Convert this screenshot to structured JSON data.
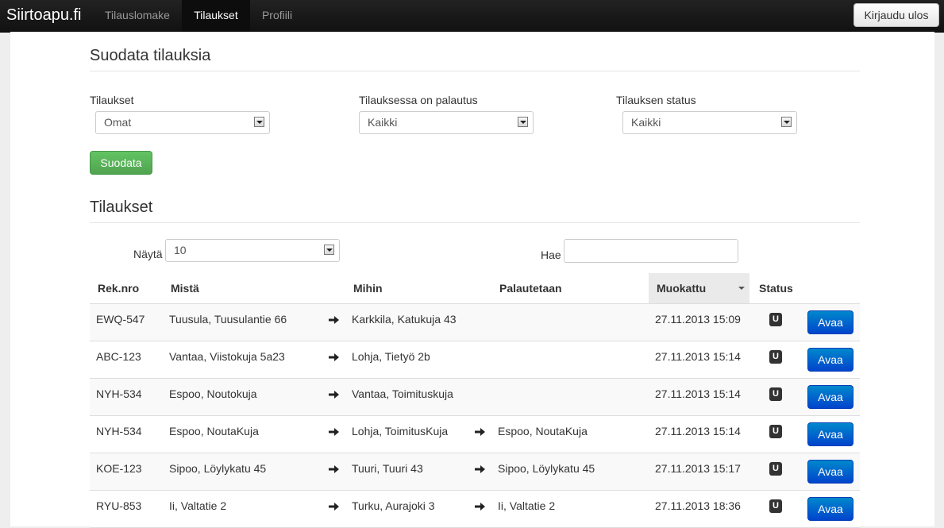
{
  "navbar": {
    "brand": "Siirtoapu.fi",
    "items": [
      {
        "label": "Tilauslomake"
      },
      {
        "label": "Tilaukset"
      },
      {
        "label": "Profiili"
      }
    ],
    "logout_label": "Kirjaudu ulos"
  },
  "filter": {
    "title": "Suodata tilauksia",
    "orders_label": "Tilaukset",
    "orders_value": "Omat",
    "return_label": "Tilauksessa on palautus",
    "return_value": "Kaikki",
    "status_label": "Tilauksen status",
    "status_value": "Kaikki",
    "submit_label": "Suodata"
  },
  "orders": {
    "title": "Tilaukset",
    "show_label": "Näytä",
    "show_value": "10",
    "search_label": "Hae",
    "search_value": "",
    "columns": {
      "reg": "Rek.nro",
      "from": "Mistä",
      "to": "Mihin",
      "return": "Palautetaan",
      "modified": "Muokattu",
      "status": "Status"
    },
    "open_label": "Avaa",
    "rows": [
      {
        "reg": "EWQ-547",
        "from": "Tuusula, Tuusulantie 66",
        "to": "Karkkila, Katukuja 43",
        "return": "",
        "modified": "27.11.2013 15:09",
        "status": "U"
      },
      {
        "reg": "ABC-123",
        "from": "Vantaa, Viistokuja 5a23",
        "to": "Lohja, Tietyö 2b",
        "return": "",
        "modified": "27.11.2013 15:14",
        "status": "U"
      },
      {
        "reg": "NYH-534",
        "from": "Espoo, Noutokuja",
        "to": "Vantaa, Toimituskuja",
        "return": "",
        "modified": "27.11.2013 15:14",
        "status": "U"
      },
      {
        "reg": "NYH-534",
        "from": "Espoo, NoutaKuja",
        "to": "Lohja, ToimitusKuja",
        "return": "Espoo, NoutaKuja",
        "modified": "27.11.2013 15:14",
        "status": "U"
      },
      {
        "reg": "KOE-123",
        "from": "Sipoo, Löylykatu 45",
        "to": "Tuuri, Tuuri 43",
        "return": "Sipoo, Löylykatu 45",
        "modified": "27.11.2013 15:17",
        "status": "U"
      },
      {
        "reg": "RYU-853",
        "from": "Ii, Valtatie 2",
        "to": "Turku, Aurajoki 3",
        "return": "Ii, Valtatie 2",
        "modified": "27.11.2013 18:36",
        "status": "U"
      }
    ]
  }
}
